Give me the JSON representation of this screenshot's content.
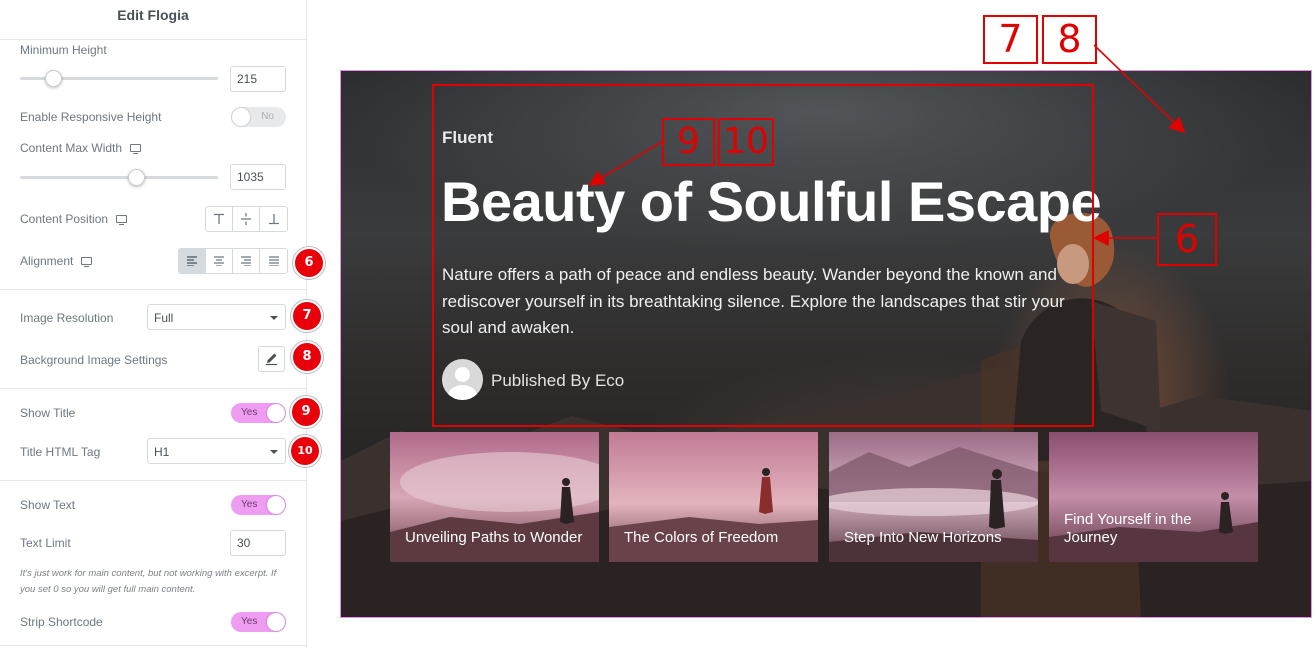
{
  "panel": {
    "title": "Edit Flogia",
    "min_height": {
      "label": "Minimum Height",
      "value": "215",
      "slider_fraction": 0.17
    },
    "responsive_height": {
      "label": "Enable Responsive Height",
      "toggle": "No"
    },
    "content_max_width": {
      "label": "Content Max Width",
      "value": "1035",
      "slider_fraction": 0.59
    },
    "content_position": {
      "label": "Content Position",
      "options": [
        "top-icon",
        "middle-icon",
        "bottom-icon"
      ]
    },
    "alignment": {
      "label": "Alignment",
      "options": [
        "align-left-icon",
        "align-center-icon",
        "align-right-icon",
        "align-justify-icon"
      ],
      "selected": 0
    },
    "image_resolution": {
      "label": "Image Resolution",
      "value": "Full"
    },
    "background_image_settings": {
      "label": "Background Image Settings"
    },
    "show_title": {
      "label": "Show Title",
      "toggle": "Yes"
    },
    "title_html_tag": {
      "label": "Title HTML Tag",
      "value": "H1"
    },
    "show_text": {
      "label": "Show Text",
      "toggle": "Yes"
    },
    "text_limit": {
      "label": "Text Limit",
      "value": "30"
    },
    "text_limit_note": "It's just work for main content, but not working with excerpt. If you set 0 so you will get full main content.",
    "strip_shortcode": {
      "label": "Strip Shortcode",
      "toggle": "Yes"
    }
  },
  "badges": [
    "6",
    "7",
    "8",
    "9",
    "10"
  ],
  "preview": {
    "category": "Fluent",
    "title": "Beauty of Soulful Escape",
    "text": "Nature offers a path of peace and endless beauty. Wander beyond the known and rediscover yourself in its breathtaking silence. Explore the landscapes that stir your soul and awaken.",
    "author": "Published By Eco",
    "cards": [
      {
        "title": "Unveiling Paths to Wonder"
      },
      {
        "title": "The Colors of Freedom"
      },
      {
        "title": "Step Into New Horizons"
      },
      {
        "title": "Find Yourself in the Journey"
      }
    ]
  },
  "annotations": [
    "7",
    "8",
    "9",
    "10",
    "6"
  ],
  "colors": {
    "accent_pink": "#ef9df2",
    "annotation_red": "#e00000",
    "badge_red": "#e8000b",
    "panel_text": "#6d7882"
  }
}
